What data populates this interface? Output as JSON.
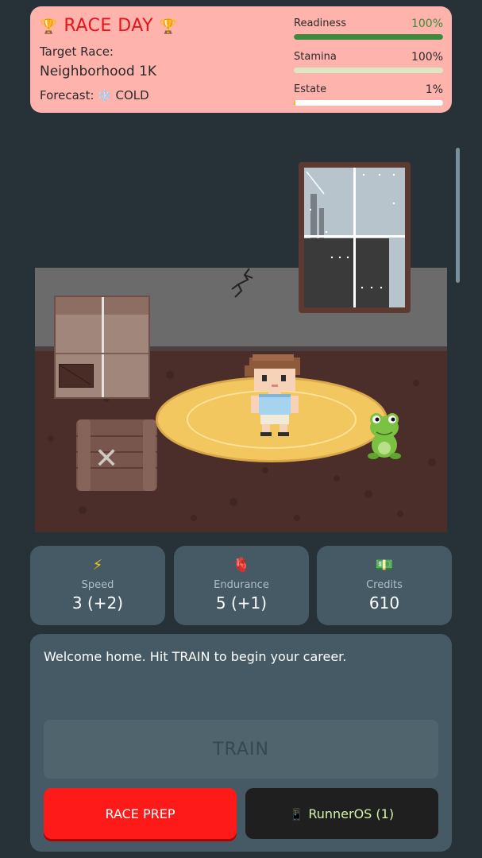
{
  "race_card": {
    "title": "RACE DAY",
    "trophy": "🏆",
    "target_label": "Target Race:",
    "target_name": "Neighborhood 1K",
    "forecast_label": "Forecast:",
    "forecast_icon": "❄️",
    "forecast_value": "COLD",
    "meters": [
      {
        "label": "Readiness",
        "value": "100%",
        "fraction": 1.0,
        "color": "#3c8a3c"
      },
      {
        "label": "Stamina",
        "value": "100%",
        "fraction": 1.0,
        "color": "#dfe6c4"
      },
      {
        "label": "Estate",
        "value": "1%",
        "fraction": 0.01,
        "color": "#ffb300"
      }
    ],
    "background": "#ffb3ad"
  },
  "stats": [
    {
      "icon": "lightning-icon",
      "glyph": "⚡",
      "label": "Speed",
      "value": "3 (+2)"
    },
    {
      "icon": "heart-icon",
      "glyph": "🫀",
      "label": "Endurance",
      "value": "5 (+1)"
    },
    {
      "icon": "money-icon",
      "glyph": "💵",
      "label": "Credits",
      "value": "610"
    }
  ],
  "panel": {
    "message": "Welcome home. Hit TRAIN to begin your career.",
    "train_label": "TRAIN",
    "race_prep_label": "RACE PREP",
    "runneros_label": "RunnerOS (1)",
    "phone_glyph": "📱"
  },
  "colors": {
    "background": "#263238",
    "card": "#455a64",
    "race_prep": "#ff1a1a",
    "runneros_text": "#d4f5a8"
  }
}
